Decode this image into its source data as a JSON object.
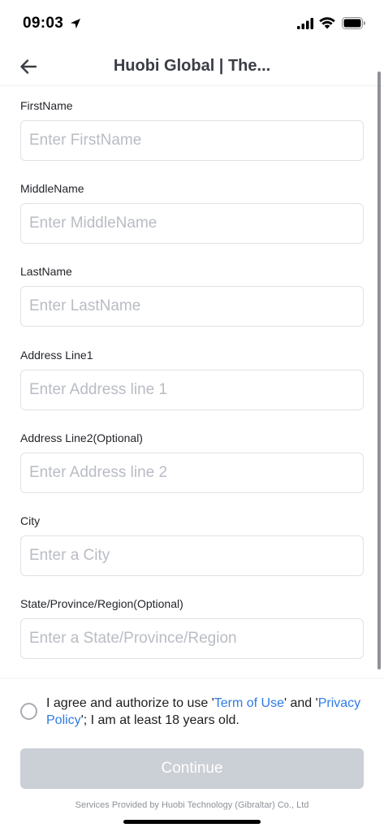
{
  "status_bar": {
    "time": "09:03"
  },
  "header": {
    "title": "Huobi Global | The..."
  },
  "form": {
    "fields": [
      {
        "label": "FirstName",
        "placeholder": "Enter FirstName",
        "value": ""
      },
      {
        "label": "MiddleName",
        "placeholder": "Enter MiddleName",
        "value": ""
      },
      {
        "label": "LastName",
        "placeholder": "Enter LastName",
        "value": ""
      },
      {
        "label": "Address Line1",
        "placeholder": "Enter Address line 1",
        "value": ""
      },
      {
        "label": "Address Line2(Optional)",
        "placeholder": "Enter Address line 2",
        "value": ""
      },
      {
        "label": "City",
        "placeholder": "Enter a City",
        "value": ""
      },
      {
        "label": "State/Province/Region(Optional)",
        "placeholder": "Enter a State/Province/Region",
        "value": ""
      }
    ]
  },
  "agreement": {
    "checked": false,
    "prefix": "I agree and authorize to use '",
    "term_link": "Term of Use",
    "middle": "' and '",
    "privacy_link": "Privacy Policy",
    "suffix": "'; I am at least 18 years old."
  },
  "footer": {
    "continue_label": "Continue",
    "provider_text": "Services Provided by Huobi Technology (Gibraltar) Co., Ltd"
  },
  "colors": {
    "link": "#2d7be5",
    "button_disabled": "#cbcfd6",
    "placeholder": "#b9bcc4",
    "input_border": "#dfe2e7"
  }
}
